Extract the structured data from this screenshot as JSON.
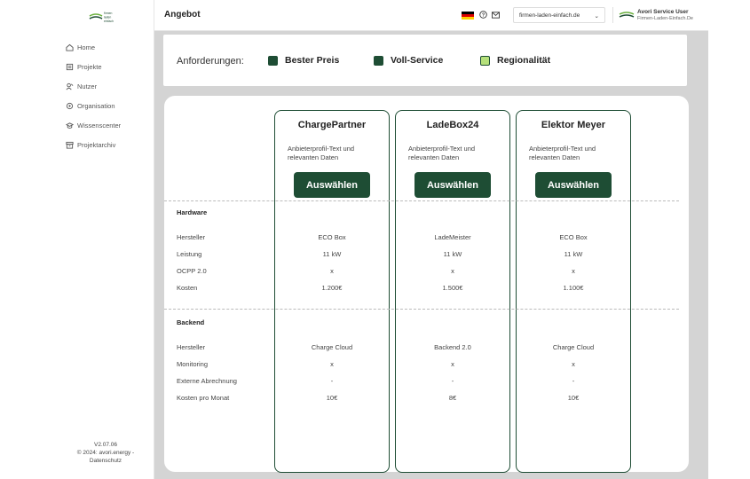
{
  "sidebar": {
    "brand_lines": [
      "firmen",
      "laden",
      "einfach"
    ],
    "items": [
      {
        "label": "Home",
        "icon": "home-icon"
      },
      {
        "label": "Projekte",
        "icon": "projects-icon"
      },
      {
        "label": "Nutzer",
        "icon": "users-icon"
      },
      {
        "label": "Organisation",
        "icon": "organisation-icon"
      },
      {
        "label": "Wissenscenter",
        "icon": "knowledge-icon"
      },
      {
        "label": "Projektarchiv",
        "icon": "archive-icon"
      }
    ],
    "version": "V2.07.06",
    "copyright": "© 2024: avori.energy -",
    "privacy": "Datenschutz"
  },
  "header": {
    "title": "Angebot",
    "domain": "firmen-laden-einfach.de",
    "user_name": "Avori Service User",
    "user_domain": "Firmen-Laden-Einfach.De"
  },
  "requirements": {
    "label": "Anforderungen:",
    "items": [
      {
        "label": "Bester Preis",
        "color": "#1e4d34"
      },
      {
        "label": "Voll-Service",
        "color": "#1e4d34"
      },
      {
        "label": "Regionalität",
        "color": "#b5e07a"
      }
    ]
  },
  "providers": [
    {
      "name": "ChargePartner",
      "description": "Anbieterprofil-Text und relevanten Daten",
      "button": "Auswählen",
      "hardware": [
        "ECO Box",
        "11 kW",
        "x",
        "1.200€"
      ],
      "backend": [
        "Charge Cloud",
        "x",
        "-",
        "10€"
      ]
    },
    {
      "name": "LadeBox24",
      "description": "Anbieterprofil-Text und relevanten Daten",
      "button": "Auswählen",
      "hardware": [
        "LadeMeister",
        "11 kW",
        "x",
        "1.500€"
      ],
      "backend": [
        "Backend 2.0",
        "x",
        "-",
        "8€"
      ]
    },
    {
      "name": "Elektor Meyer",
      "description": "Anbieterprofil-Text und relevanten Daten",
      "button": "Auswählen",
      "hardware": [
        "ECO Box",
        "11 kW",
        "x",
        "1.100€"
      ],
      "backend": [
        "Charge Cloud",
        "x",
        "-",
        "10€"
      ]
    }
  ],
  "sections": {
    "hardware": {
      "title": "Hardware",
      "rows": [
        "Hersteller",
        "Leistung",
        "OCPP 2.0",
        "Kosten"
      ]
    },
    "backend": {
      "title": "Backend",
      "rows": [
        "Hersteller",
        "Monitoring",
        "Externe Abrechnung",
        "Kosten pro Monat"
      ]
    }
  },
  "colors": {
    "brand": "#1e4d34",
    "accent": "#b5e07a",
    "background": "#d4d4d4"
  }
}
